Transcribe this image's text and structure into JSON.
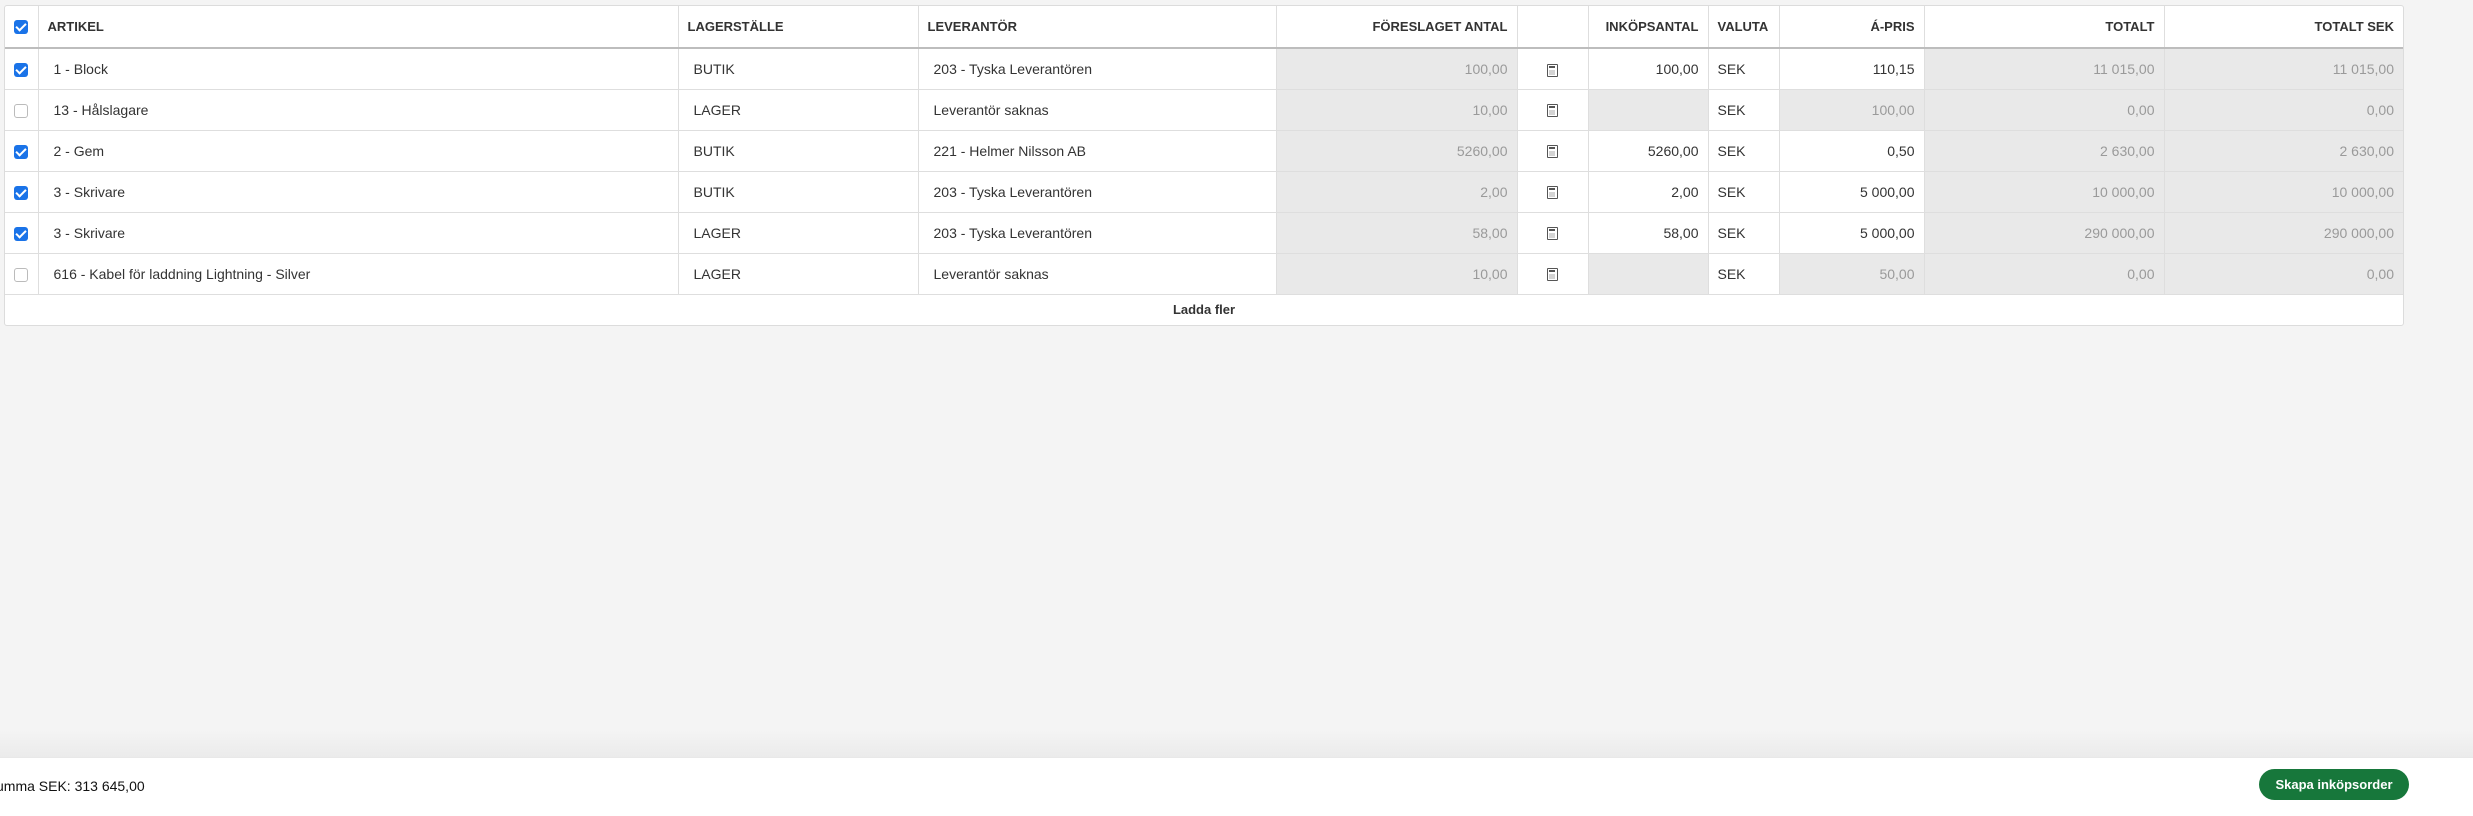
{
  "table": {
    "columns": {
      "artikel": "ARTIKEL",
      "lagerstalle": "LAGERSTÄLLE",
      "leverantor": "LEVERANTÖR",
      "foreslaget": "FÖRESLAGET ANTAL",
      "calc": "",
      "inkopsantal": "INKÖPSANTAL",
      "valuta": "VALUTA",
      "apris": "Á-PRIS",
      "totalt": "TOTALT",
      "totalt_sek": "TOTALT SEK"
    },
    "header_checked": true,
    "rows": [
      {
        "checked": true,
        "artikel": "1 - Block",
        "lagerstalle": "BUTIK",
        "leverantor": "203 - Tyska Leverantören",
        "foreslaget": "100,00",
        "inkopsantal": "100,00",
        "valuta": "SEK",
        "apris": "110,15",
        "totalt": "11 015,00",
        "totalt_sek": "11 015,00"
      },
      {
        "checked": false,
        "artikel": "13 - Hålslagare",
        "lagerstalle": "LAGER",
        "leverantor": "Leverantör saknas",
        "foreslaget": "10,00",
        "inkopsantal": "",
        "valuta": "SEK",
        "apris": "100,00",
        "totalt": "0,00",
        "totalt_sek": "0,00"
      },
      {
        "checked": true,
        "artikel": "2 - Gem",
        "lagerstalle": "BUTIK",
        "leverantor": "221 - Helmer Nilsson AB",
        "foreslaget": "5260,00",
        "inkopsantal": "5260,00",
        "valuta": "SEK",
        "apris": "0,50",
        "totalt": "2 630,00",
        "totalt_sek": "2 630,00"
      },
      {
        "checked": true,
        "artikel": "3 - Skrivare",
        "lagerstalle": "BUTIK",
        "leverantor": "203 - Tyska Leverantören",
        "foreslaget": "2,00",
        "inkopsantal": "2,00",
        "valuta": "SEK",
        "apris": "5 000,00",
        "totalt": "10 000,00",
        "totalt_sek": "10 000,00"
      },
      {
        "checked": true,
        "artikel": "3 - Skrivare",
        "lagerstalle": "LAGER",
        "leverantor": "203 - Tyska Leverantören",
        "foreslaget": "58,00",
        "inkopsantal": "58,00",
        "valuta": "SEK",
        "apris": "5 000,00",
        "totalt": "290 000,00",
        "totalt_sek": "290 000,00"
      },
      {
        "checked": false,
        "artikel": "616 - Kabel för laddning Lightning - Silver",
        "lagerstalle": "LAGER",
        "leverantor": "Leverantör saknas",
        "foreslaget": "10,00",
        "inkopsantal": "",
        "valuta": "SEK",
        "apris": "50,00",
        "totalt": "0,00",
        "totalt_sek": "0,00"
      }
    ],
    "load_more_label": "Ladda fler"
  },
  "footer": {
    "sum_text": "umma SEK: 313 645,00",
    "create_button_label": "Skapa inköpsorder"
  },
  "icons": {
    "calculator": "calculator-icon"
  },
  "colors": {
    "checkbox_blue": "#1a73e8",
    "button_green": "#17773b",
    "readonly_grey": "#e9e9e9"
  }
}
